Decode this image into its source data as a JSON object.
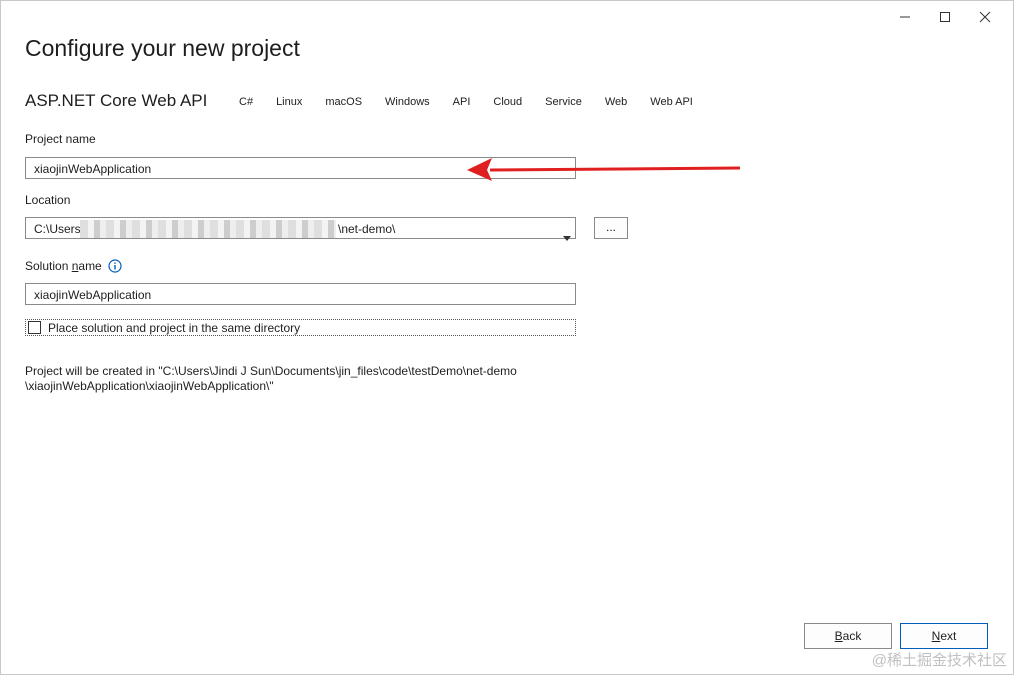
{
  "window": {
    "controls": [
      "minimize-icon",
      "maximize-icon",
      "close-icon"
    ]
  },
  "page_title": "Configure your new project",
  "template": {
    "name": "ASP.NET Core Web API",
    "tags": [
      "C#",
      "Linux",
      "macOS",
      "Windows",
      "API",
      "Cloud",
      "Service",
      "Web",
      "Web API"
    ]
  },
  "project_name": {
    "label": "Project name",
    "value": "xiaojinWebApplication"
  },
  "location": {
    "label": "Location",
    "value_start": "C:\\Users",
    "value_end": "\\net-demo\\",
    "browse_label": "..."
  },
  "solution_name": {
    "label_prefix": "Solution ",
    "label_underlined": "n",
    "label_suffix": "ame",
    "value": "xiaojinWebApplication"
  },
  "same_directory": {
    "label": "Place solution and project in the same directory",
    "checked": false
  },
  "created_path": {
    "line1": "Project will be created in \"C:\\Users\\Jindi J Sun\\Documents\\jin_files\\code\\testDemo\\net-demo",
    "line2": "\\xiaojinWebApplication\\xiaojinWebApplication\\\""
  },
  "buttons": {
    "back_mnemonic": "B",
    "back_rest": "ack",
    "next_mnemonic": "N",
    "next_rest": "ext"
  },
  "watermark": "@稀土掘金技术社区",
  "colors": {
    "arrow": "#e02020",
    "primary_border": "#005fb8",
    "info_icon": "#005fb8"
  }
}
